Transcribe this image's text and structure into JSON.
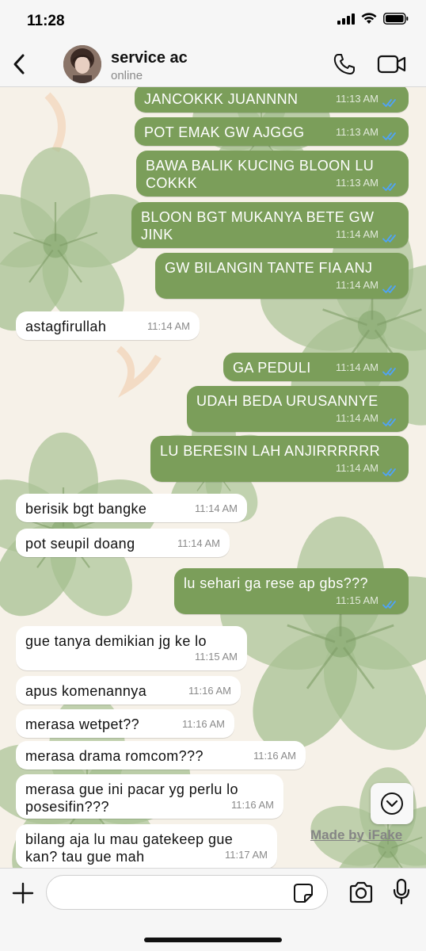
{
  "status_bar": {
    "time": "11:28"
  },
  "header": {
    "contact_name": "service ac",
    "contact_status": "online"
  },
  "colors": {
    "outgoing_bubble": "#7b9e5a",
    "incoming_bubble": "#ffffff",
    "read_ticks": "#4fa3f7"
  },
  "messages": [
    {
      "dir": "out",
      "text": "JANCOKKK JUANNNN",
      "time": "11:13 AM",
      "read": true
    },
    {
      "dir": "out",
      "text": "POT EMAK GW AJGGG",
      "time": "11:13 AM",
      "read": true
    },
    {
      "dir": "out",
      "text": "BAWA BALIK KUCING BLOON LU COKKK",
      "time": "11:13 AM",
      "read": true
    },
    {
      "dir": "out",
      "text": "BLOON BGT MUKANYA BETE GW JINK",
      "time": "11:14 AM",
      "read": true
    },
    {
      "dir": "out",
      "text": "GW BILANGIN TANTE FIA ANJ",
      "time": "11:14 AM",
      "read": true
    },
    {
      "dir": "in",
      "text": "astagfirullah",
      "time": "11:14 AM"
    },
    {
      "dir": "out",
      "text": "GA PEDULI",
      "time": "11:14 AM",
      "read": true
    },
    {
      "dir": "out",
      "text": "UDAH BEDA URUSANNYE",
      "time": "11:14 AM",
      "read": true
    },
    {
      "dir": "out",
      "text": "LU BERESIN LAH ANJIRRRRRR",
      "time": "11:14 AM",
      "read": true
    },
    {
      "dir": "in",
      "text": "berisik bgt bangke",
      "time": "11:14 AM"
    },
    {
      "dir": "in",
      "text": "pot seupil doang",
      "time": "11:14 AM"
    },
    {
      "dir": "out",
      "text": "lu sehari ga rese ap gbs???",
      "time": "11:15 AM",
      "read": true
    },
    {
      "dir": "in",
      "text": "gue tanya demikian jg ke lo",
      "time": "11:15 AM"
    },
    {
      "dir": "in",
      "text": "apus komenannya",
      "time": "11:16 AM"
    },
    {
      "dir": "in",
      "text": "merasa wetpet??",
      "time": "11:16 AM"
    },
    {
      "dir": "in",
      "text": "merasa drama romcom???",
      "time": "11:16 AM"
    },
    {
      "dir": "in",
      "text": "merasa gue ini pacar yg perlu lo posesifin???",
      "time": "11:16 AM"
    },
    {
      "dir": "in",
      "text": "bilang aja lu mau gatekeep gue kan? tau gue mah",
      "time": "11:17 AM"
    }
  ],
  "watermark": "Made by iFake",
  "composer": {
    "value": "",
    "placeholder": ""
  },
  "icons": {
    "back": "chevron-left-icon",
    "call": "phone-icon",
    "video": "video-camera-icon",
    "scroll": "chevron-down-icon",
    "plus": "plus-icon",
    "sticker": "sticker-icon",
    "camera": "camera-icon",
    "mic": "microphone-icon"
  }
}
